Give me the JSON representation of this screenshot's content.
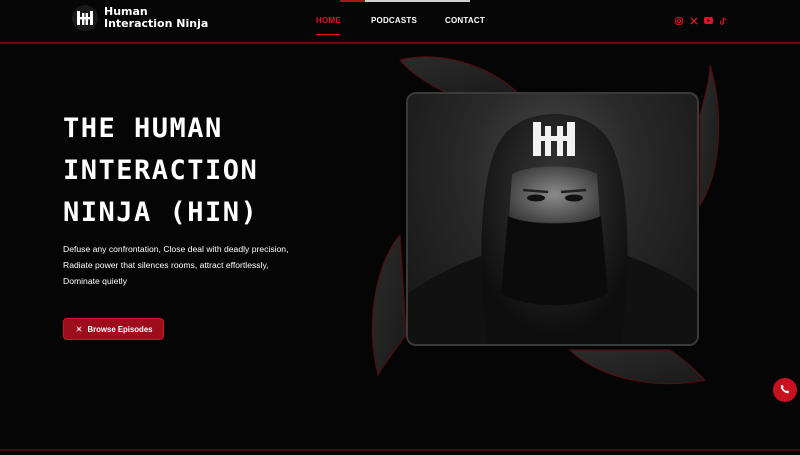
{
  "brand": {
    "line1": "Human",
    "line2": "Interaction Ninja",
    "logo_icon": "hh-monogram-icon"
  },
  "nav": {
    "items": [
      {
        "label": "HOME",
        "active": true
      },
      {
        "label": "PODCASTS",
        "active": false
      },
      {
        "label": "CONTACT",
        "active": false
      }
    ]
  },
  "social": {
    "icons": [
      "instagram-icon",
      "x-icon",
      "youtube-icon",
      "tiktok-icon"
    ]
  },
  "hero": {
    "title_lines": [
      "THE HUMAN",
      "INTERACTION",
      "NINJA (HIN)"
    ],
    "description_lines": [
      "Defuse any confrontation, Close deal with deadly precision,",
      "Radiate power that silences rooms, attract effortlessly,",
      "Dominate quietly"
    ],
    "cta_label": "Browse Episodes",
    "cta_icon": "shuriken-icon"
  },
  "floating": {
    "call_icon": "phone-icon"
  },
  "colors": {
    "accent": "#e3102b",
    "button": "#9e0d1c",
    "background": "#050505"
  }
}
